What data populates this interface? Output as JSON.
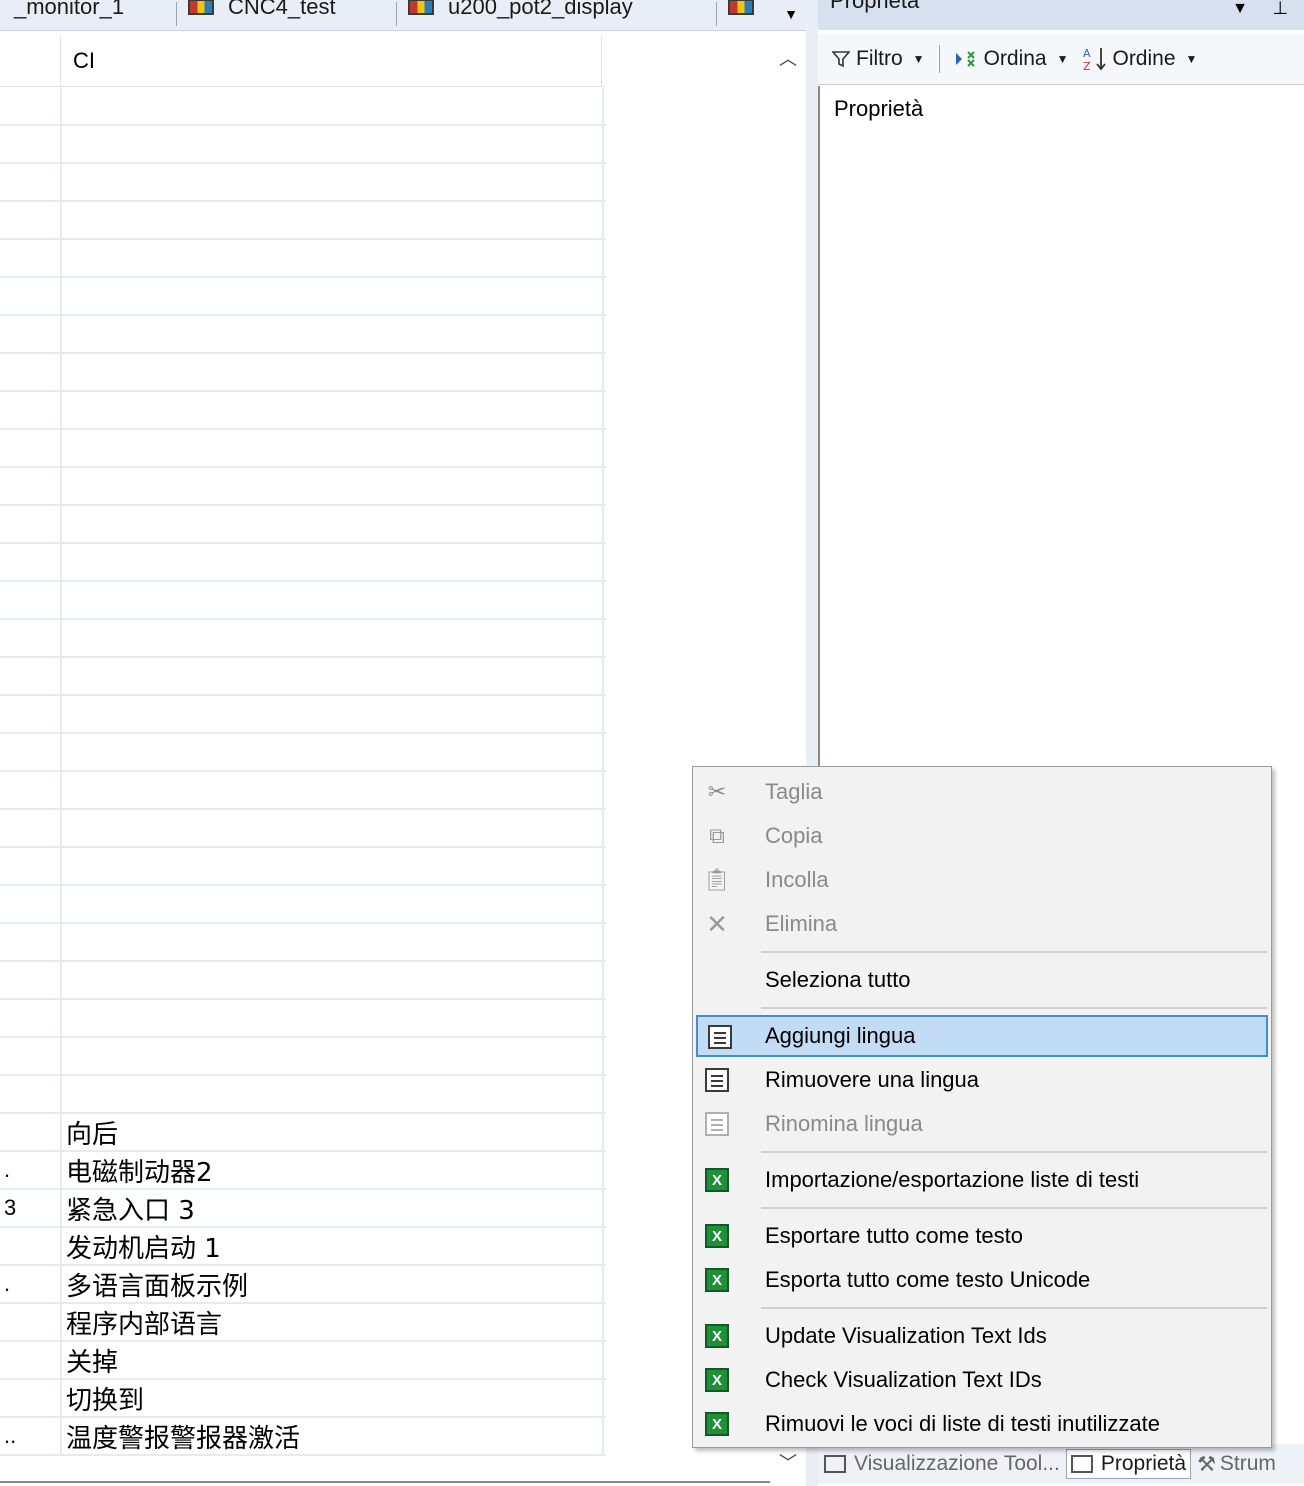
{
  "doc_tabs": [
    {
      "label": "_monitor_1"
    },
    {
      "label": "CNC4_test"
    },
    {
      "label": "u200_pot2_display"
    },
    {
      "label": ""
    }
  ],
  "grid": {
    "column_header": "CI",
    "rows": [
      {
        "c0": "",
        "c1": ""
      },
      {
        "c0": "",
        "c1": ""
      },
      {
        "c0": "",
        "c1": ""
      },
      {
        "c0": "",
        "c1": ""
      },
      {
        "c0": "",
        "c1": ""
      },
      {
        "c0": "",
        "c1": ""
      },
      {
        "c0": "",
        "c1": ""
      },
      {
        "c0": "",
        "c1": ""
      },
      {
        "c0": "",
        "c1": ""
      },
      {
        "c0": "",
        "c1": ""
      },
      {
        "c0": "",
        "c1": ""
      },
      {
        "c0": "",
        "c1": ""
      },
      {
        "c0": "",
        "c1": ""
      },
      {
        "c0": "",
        "c1": ""
      },
      {
        "c0": "",
        "c1": ""
      },
      {
        "c0": "",
        "c1": ""
      },
      {
        "c0": "",
        "c1": ""
      },
      {
        "c0": "",
        "c1": ""
      },
      {
        "c0": "",
        "c1": ""
      },
      {
        "c0": "",
        "c1": ""
      },
      {
        "c0": "",
        "c1": ""
      },
      {
        "c0": "",
        "c1": ""
      },
      {
        "c0": "",
        "c1": ""
      },
      {
        "c0": "",
        "c1": ""
      },
      {
        "c0": "",
        "c1": ""
      },
      {
        "c0": "",
        "c1": ""
      },
      {
        "c0": "",
        "c1": ""
      },
      {
        "c0": "",
        "c1": "向后"
      },
      {
        "c0": ".",
        "c1": "电磁制动器2"
      },
      {
        "c0": "3",
        "c1": "紧急入口 3"
      },
      {
        "c0": "",
        "c1": "发动机启动 1"
      },
      {
        "c0": ".",
        "c1": "多语言面板示例"
      },
      {
        "c0": "",
        "c1": "程序内部语言"
      },
      {
        "c0": "",
        "c1": "关掉"
      },
      {
        "c0": "",
        "c1": "切换到"
      },
      {
        "c0": "..",
        "c1": "温度警报警报器激活"
      }
    ]
  },
  "props": {
    "title": "Proprietà",
    "toolbar": {
      "filter_label": "Filtro",
      "sort_label": "Ordina",
      "order_label": "Ordine"
    },
    "heading": "Proprietà",
    "bottom_tabs": [
      {
        "label": "Visualizzazione Tool..."
      },
      {
        "label": "Proprietà"
      },
      {
        "label": "Strum"
      }
    ]
  },
  "context_menu": {
    "items": [
      {
        "label": "Taglia",
        "icon": "scissors-icon",
        "disabled": true
      },
      {
        "label": "Copia",
        "icon": "copy-icon",
        "disabled": true
      },
      {
        "label": "Incolla",
        "icon": "paste-icon",
        "disabled": true
      },
      {
        "label": "Elimina",
        "icon": "delete-icon",
        "disabled": true
      },
      {
        "label": "Seleziona tutto",
        "icon": "",
        "disabled": false
      },
      {
        "label": "Aggiungi lingua",
        "icon": "add-language-icon",
        "disabled": false,
        "highlighted": true
      },
      {
        "label": "Rimuovere una lingua",
        "icon": "remove-language-icon",
        "disabled": false
      },
      {
        "label": "Rinomina lingua",
        "icon": "rename-language-icon",
        "disabled": true
      },
      {
        "label": "Importazione/esportazione liste di testi",
        "icon": "excel-icon",
        "disabled": false
      },
      {
        "label": "Esportare tutto come testo",
        "icon": "excel-icon",
        "disabled": false
      },
      {
        "label": "Esporta tutto come testo Unicode",
        "icon": "excel-icon",
        "disabled": false
      },
      {
        "label": "Update Visualization Text Ids",
        "icon": "excel-icon",
        "disabled": false
      },
      {
        "label": "Check Visualization Text IDs",
        "icon": "excel-icon",
        "disabled": false
      },
      {
        "label": "Rimuovi le voci di liste di testi inutilizzate",
        "icon": "excel-icon",
        "disabled": false
      }
    ]
  },
  "colors": {
    "menu_highlight": "#c3dcf5",
    "menu_highlight_border": "#3d8fd8",
    "excel_green": "#1f8f3a"
  }
}
